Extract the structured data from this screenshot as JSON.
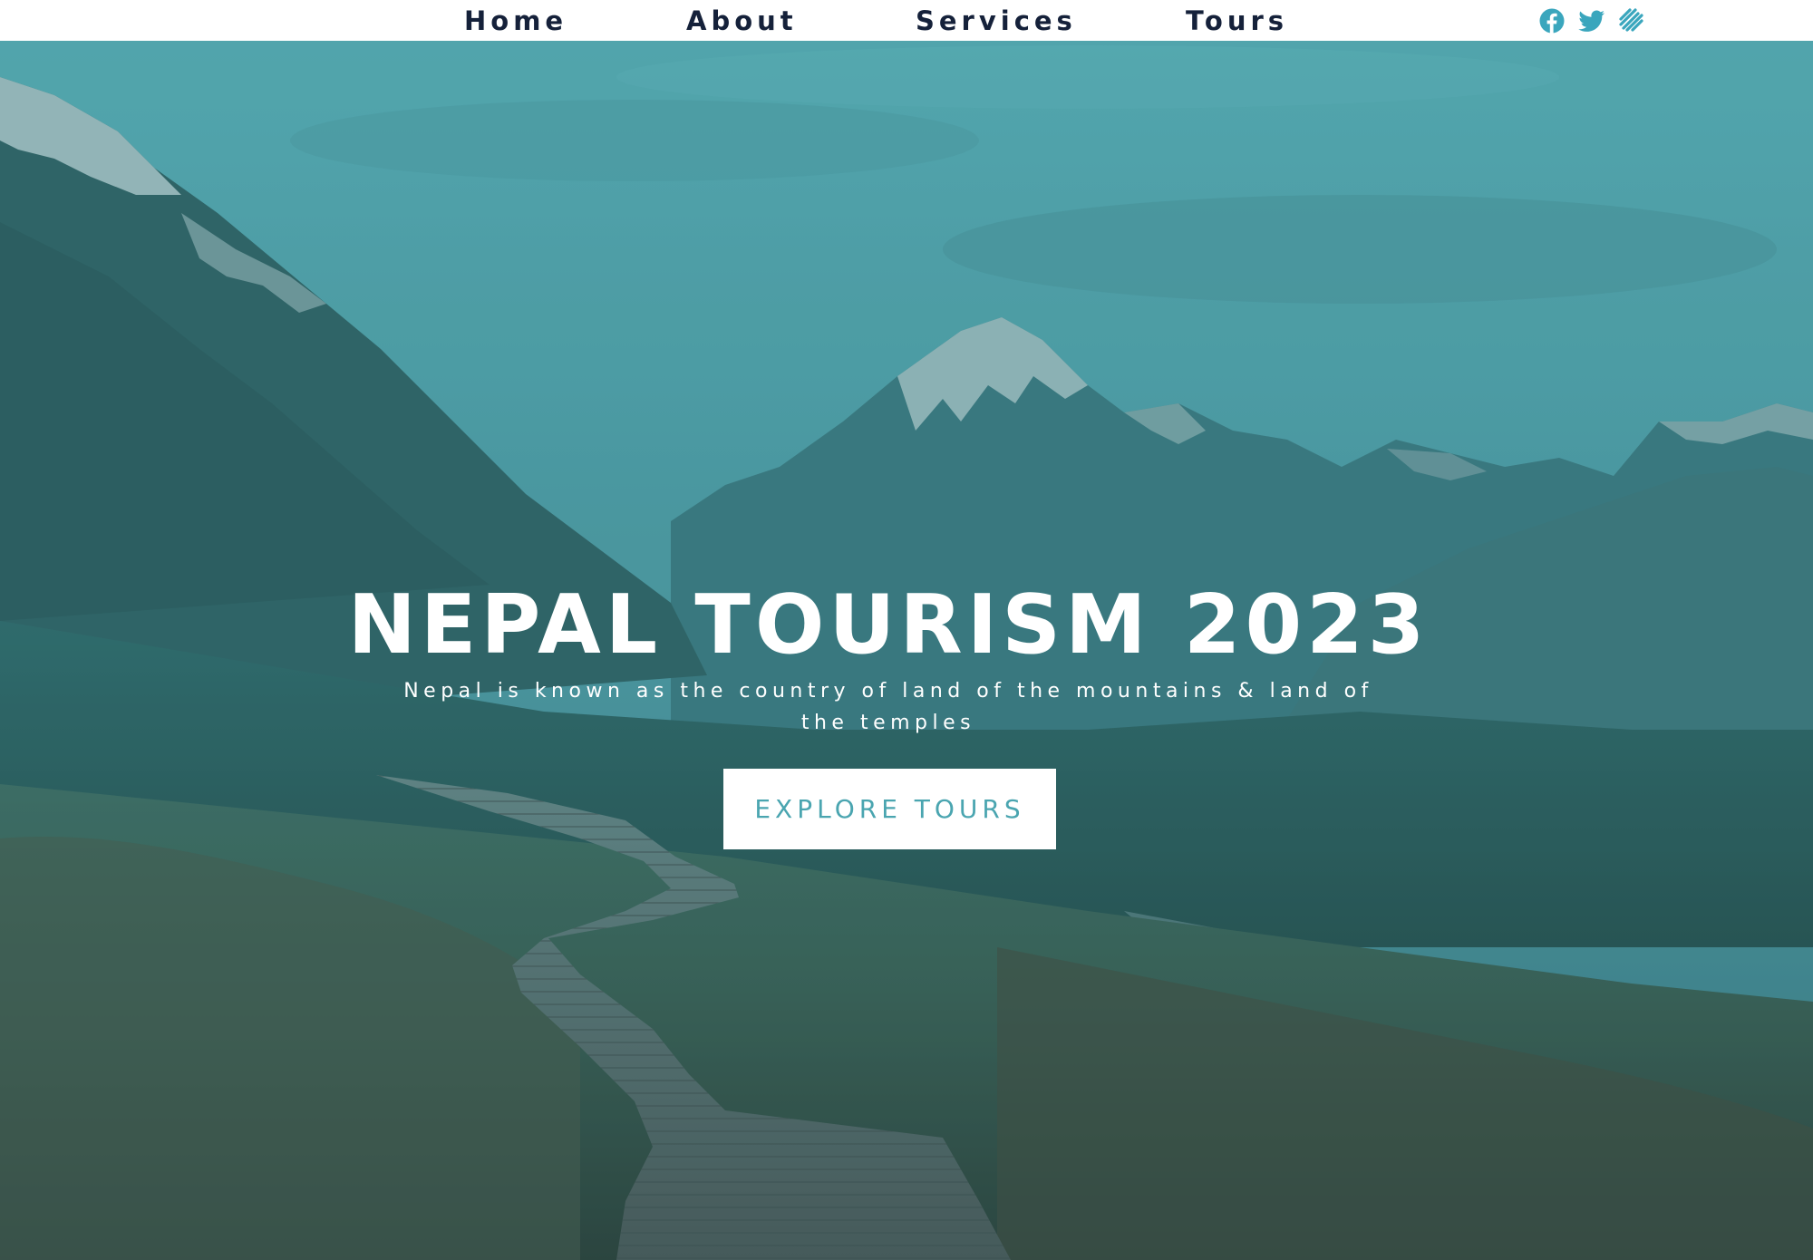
{
  "nav": {
    "links": [
      "Home",
      "About",
      "Services",
      "Tours"
    ]
  },
  "social": {
    "icons": [
      "facebook-icon",
      "twitter-icon",
      "stack-icon"
    ],
    "color": "#3aa6bd"
  },
  "hero": {
    "title": "NEPAL TOURISM 2023",
    "subtitle": "Nepal is known as the country of land of the mountains & land of the temples",
    "cta_label": "EXPLORE TOURS",
    "overlay_color": "#5ab8be"
  }
}
